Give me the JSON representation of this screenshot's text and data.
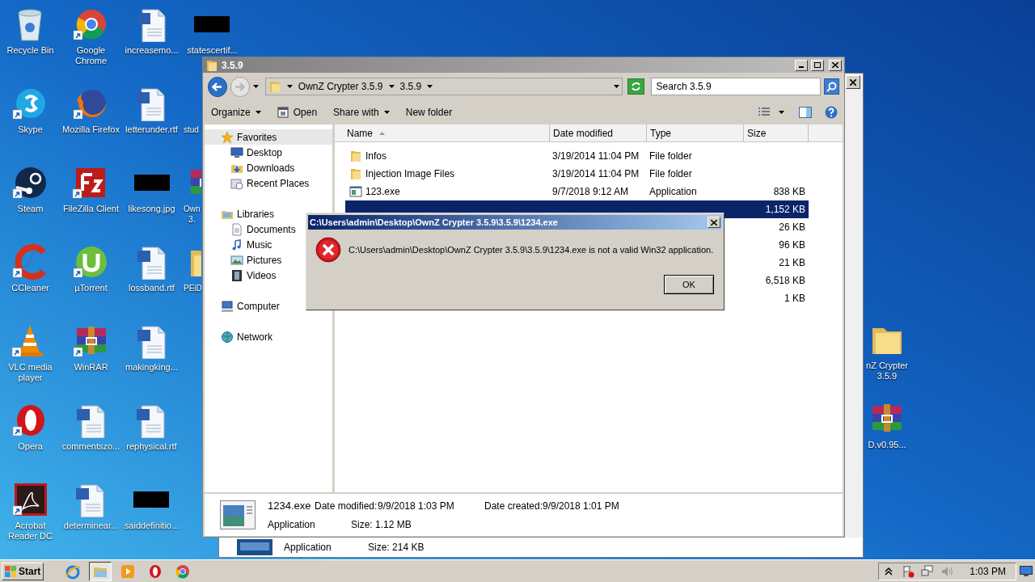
{
  "desktop": {
    "columns": [
      [
        {
          "label": "Recycle Bin",
          "kind": "recycle"
        },
        {
          "label": "Skype",
          "kind": "skype"
        },
        {
          "label": "Steam",
          "kind": "steam"
        },
        {
          "label": "CCleaner",
          "kind": "ccleaner"
        },
        {
          "label": "VLC media\nplayer",
          "kind": "vlc"
        },
        {
          "label": "Opera",
          "kind": "opera"
        },
        {
          "label": "Acrobat\nReader DC",
          "kind": "acrobat"
        }
      ],
      [
        {
          "label": "Google\nChrome",
          "kind": "chrome"
        },
        {
          "label": "Mozilla Firefox",
          "kind": "firefox"
        },
        {
          "label": "FileZilla Client",
          "kind": "filezilla"
        },
        {
          "label": "µTorrent",
          "kind": "utorrent"
        },
        {
          "label": "WinRAR",
          "kind": "winrar"
        },
        {
          "label": "commentszo...",
          "kind": "word"
        },
        {
          "label": "determinear...",
          "kind": "word"
        }
      ],
      [
        {
          "label": "increasemo...",
          "kind": "word"
        },
        {
          "label": "letterunder.rtf",
          "kind": "word"
        },
        {
          "label": "likesong.jpg",
          "kind": "redacted"
        },
        {
          "label": "lossband.rtf",
          "kind": "word"
        },
        {
          "label": "makingking...",
          "kind": "word"
        },
        {
          "label": "rephysical.rtf",
          "kind": "word"
        },
        {
          "label": "saiddefinitio...",
          "kind": "redacted"
        }
      ],
      [
        {
          "label": "statescertif...",
          "kind": "redacted",
          "cut": false
        },
        {
          "label": "stud",
          "kind": "none",
          "cut": true
        },
        {
          "label": "Own\n3.",
          "kind": "winrar",
          "cut": true
        },
        {
          "label": "PEiD",
          "kind": "folder",
          "cut": true
        }
      ]
    ],
    "right_icons": [
      {
        "label": "nZ Crypter\n3.5.9",
        "kind": "folder"
      },
      {
        "label": "D.v0.95...",
        "kind": "winrar"
      }
    ]
  },
  "background_window": {
    "type": "Application",
    "size_label": "Size:",
    "size": "214 KB"
  },
  "explorer": {
    "title": "3.5.9",
    "breadcrumb": [
      "OwnZ Crypter 3.5.9",
      "3.5.9"
    ],
    "search": {
      "placeholder": "Search 3.5.9"
    },
    "toolbar": [
      {
        "label": "Organize",
        "kind": "menu"
      },
      {
        "label": "Open",
        "kind": "open"
      },
      {
        "label": "Share with",
        "kind": "menu"
      },
      {
        "label": "New folder",
        "kind": "plain"
      }
    ],
    "nav": [
      {
        "label": "Favorites",
        "kind": "star",
        "selected": true,
        "children": [
          {
            "label": "Desktop",
            "kind": "desktop",
            "selected": false
          },
          {
            "label": "Downloads",
            "kind": "downloads",
            "selected": false
          },
          {
            "label": "Recent Places",
            "kind": "recent",
            "selected": false
          }
        ]
      },
      {
        "label": "Libraries",
        "kind": "library",
        "selected": false,
        "children": [
          {
            "label": "Documents",
            "kind": "documents",
            "selected": false
          },
          {
            "label": "Music",
            "kind": "music",
            "selected": false
          },
          {
            "label": "Pictures",
            "kind": "pictures",
            "selected": false
          },
          {
            "label": "Videos",
            "kind": "videos",
            "selected": false
          }
        ]
      },
      {
        "label": "Computer",
        "kind": "computer",
        "selected": false
      },
      {
        "label": "Network",
        "kind": "network",
        "selected": false
      }
    ],
    "columns": [
      {
        "label": "Name",
        "sorted": true
      },
      {
        "label": "Date modified",
        "sorted": false
      },
      {
        "label": "Type",
        "sorted": false
      },
      {
        "label": "Size",
        "sorted": false
      }
    ],
    "files": [
      {
        "name": "Infos",
        "date": "3/19/2014 11:04 PM",
        "type": "File folder",
        "kind": "folder",
        "selected": false
      },
      {
        "name": "Injection Image Files",
        "date": "3/19/2014 11:04 PM",
        "type": "File folder",
        "kind": "folder",
        "selected": false
      },
      {
        "name": "123.exe",
        "date": "9/7/2018 9:12 AM",
        "type": "Application",
        "size": "838 KB",
        "kind": "exe",
        "selected": false
      },
      {
        "size": "1,152 KB",
        "selected": true
      },
      {
        "size": "26 KB",
        "selected": false
      },
      {
        "size": "96 KB",
        "selected": false
      },
      {
        "size": "21 KB",
        "selected": false
      },
      {
        "size": "6,518 KB",
        "selected": false
      },
      {
        "size": "1 KB",
        "selected": false
      }
    ],
    "details": {
      "name": "1234.exe",
      "type": "Application",
      "modified_label": "Date modified:",
      "modified": "9/9/2018 1:03 PM",
      "created_label": "Date created:",
      "created": "9/9/2018 1:01 PM",
      "size_label": "Size:",
      "size": "1.12 MB"
    }
  },
  "dialog": {
    "title": "C:\\Users\\admin\\Desktop\\OwnZ Crypter 3.5.9\\3.5.9\\1234.exe",
    "message": "C:\\Users\\admin\\Desktop\\OwnZ Crypter 3.5.9\\3.5.9\\1234.exe is not a valid Win32 application.",
    "button": "OK"
  },
  "taskbar": {
    "start": "Start",
    "apps": [
      {
        "kind": "ie",
        "active": false
      },
      {
        "kind": "explorer",
        "active": true
      },
      {
        "kind": "media",
        "active": false
      },
      {
        "kind": "opera",
        "active": false
      },
      {
        "kind": "chrome",
        "active": false
      }
    ],
    "tray": [
      {
        "kind": "chevron"
      },
      {
        "kind": "flag"
      },
      {
        "kind": "network"
      },
      {
        "kind": "volume"
      }
    ],
    "time": "1:03 PM"
  }
}
